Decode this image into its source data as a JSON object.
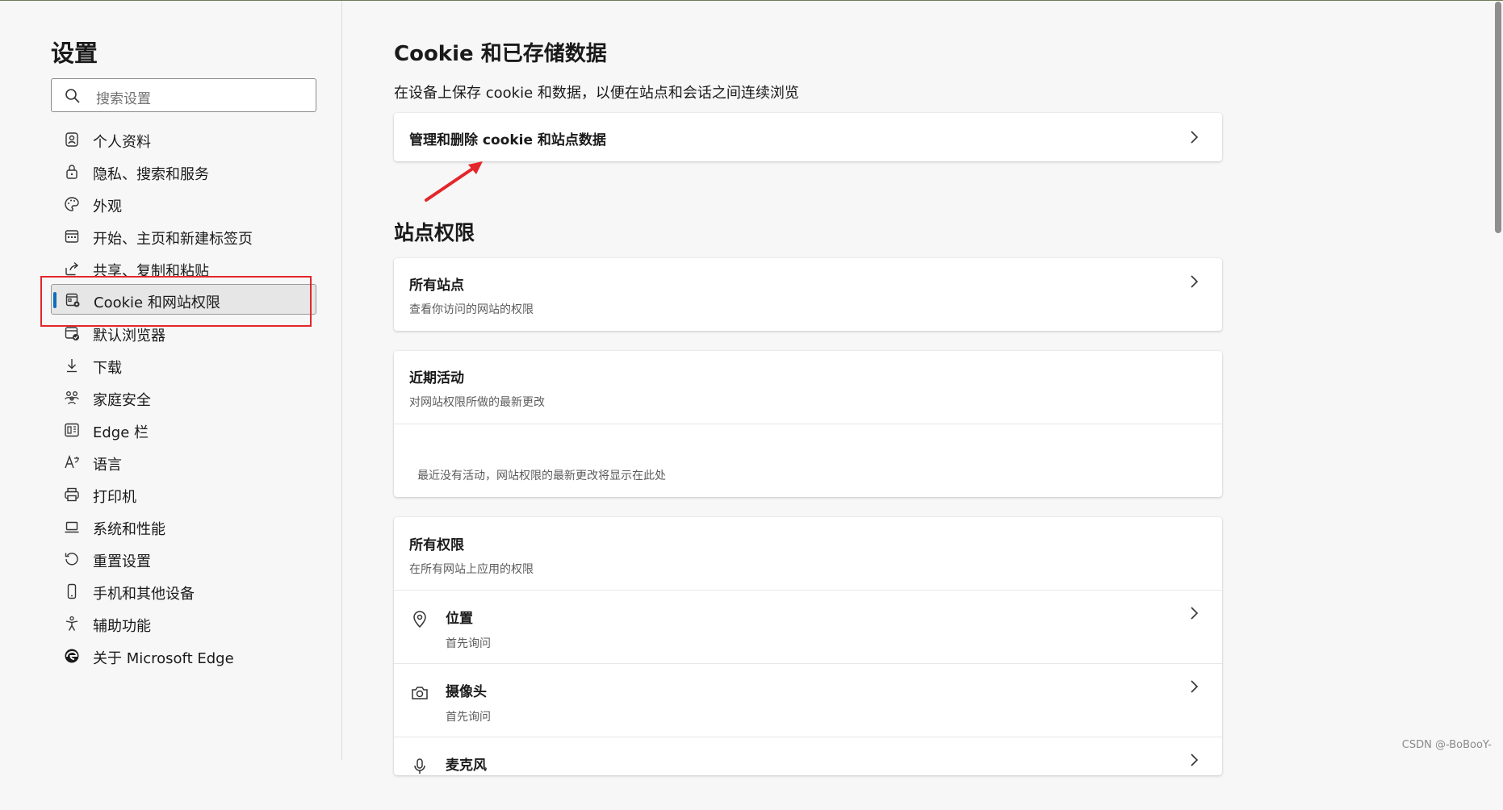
{
  "sidebar": {
    "title": "设置",
    "search_placeholder": "搜索设置",
    "items": [
      {
        "label": "个人资料",
        "icon": "profile-icon"
      },
      {
        "label": "隐私、搜索和服务",
        "icon": "lock-icon"
      },
      {
        "label": "外观",
        "icon": "palette-icon"
      },
      {
        "label": "开始、主页和新建标签页",
        "icon": "start-page-icon"
      },
      {
        "label": "共享、复制和粘贴",
        "icon": "share-icon"
      },
      {
        "label": "Cookie 和网站权限",
        "icon": "cookie-settings-icon",
        "selected": true
      },
      {
        "label": "默认浏览器",
        "icon": "default-browser-icon"
      },
      {
        "label": "下载",
        "icon": "download-icon"
      },
      {
        "label": "家庭安全",
        "icon": "family-icon"
      },
      {
        "label": "Edge 栏",
        "icon": "edge-bar-icon"
      },
      {
        "label": "语言",
        "icon": "language-icon"
      },
      {
        "label": "打印机",
        "icon": "printer-icon"
      },
      {
        "label": "系统和性能",
        "icon": "laptop-icon"
      },
      {
        "label": "重置设置",
        "icon": "reset-icon"
      },
      {
        "label": "手机和其他设备",
        "icon": "phone-icon"
      },
      {
        "label": "辅助功能",
        "icon": "accessibility-icon"
      },
      {
        "label": "关于 Microsoft Edge",
        "icon": "edge-logo-icon"
      }
    ]
  },
  "main": {
    "title": "Cookie 和已存储数据",
    "subtitle": "在设备上保存 cookie 和数据，以便在站点和会话之间连续浏览",
    "manage_cookies": "管理和删除 cookie 和站点数据",
    "site_permissions_title": "站点权限",
    "all_sites": {
      "title": "所有站点",
      "subtitle": "查看你访问的网站的权限"
    },
    "recent_activity": {
      "title": "近期活动",
      "subtitle": "对网站权限所做的最新更改",
      "empty": "最近没有活动，网站权限的最新更改将显示在此处"
    },
    "all_permissions": {
      "title": "所有权限",
      "subtitle": "在所有网站上应用的权限",
      "items": [
        {
          "title": "位置",
          "subtitle": "首先询问",
          "icon": "location-icon"
        },
        {
          "title": "摄像头",
          "subtitle": "首先询问",
          "icon": "camera-icon"
        },
        {
          "title": "麦克风",
          "icon": "microphone-icon"
        }
      ]
    }
  },
  "watermark": "CSDN @-BoBooY-",
  "colors": {
    "accent": "#0f6cbd",
    "annotation": "#e3262b"
  }
}
